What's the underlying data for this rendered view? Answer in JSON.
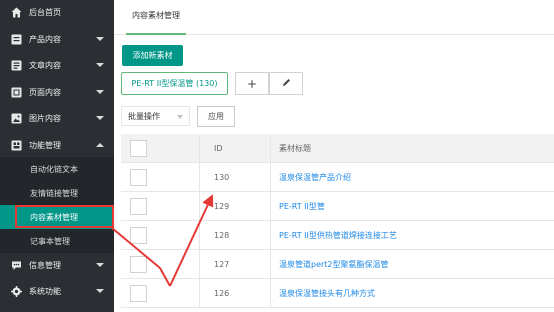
{
  "sidebar": {
    "items": [
      {
        "label": "后台首页",
        "icon": "home-icon",
        "caret": false
      },
      {
        "label": "产品内容",
        "icon": "doc-icon",
        "caret": "down"
      },
      {
        "label": "文章内容",
        "icon": "list-icon",
        "caret": "down"
      },
      {
        "label": "页面内容",
        "icon": "page-icon",
        "caret": "down"
      },
      {
        "label": "图片内容",
        "icon": "image-icon",
        "caret": "down"
      },
      {
        "label": "功能管理",
        "icon": "function-icon",
        "caret": "up"
      }
    ],
    "subitems": [
      {
        "label": "自动化链文本"
      },
      {
        "label": "友情链接管理"
      },
      {
        "label": "内容素材管理",
        "active": true
      },
      {
        "label": "记事本管理"
      }
    ],
    "bottom_items": [
      {
        "label": "信息管理",
        "icon": "chat-icon",
        "caret": "down"
      },
      {
        "label": "系统功能",
        "icon": "gear-icon",
        "caret": "down"
      }
    ]
  },
  "tab": {
    "label": "内容素材管理"
  },
  "toolbar": {
    "add_label": "添加新素材",
    "category_label": "PE-RT II型保温管 (130)",
    "plus_glyph": "+",
    "batch_label": "批量操作",
    "apply_label": "应用"
  },
  "table": {
    "headers": {
      "id": "ID",
      "title": "素材标题"
    },
    "rows": [
      {
        "id": "130",
        "title": "温泉保温管产品介绍"
      },
      {
        "id": "129",
        "title": "PE-RT II型管"
      },
      {
        "id": "128",
        "title": "PE-RT II型供热管道焊接连接工艺"
      },
      {
        "id": "127",
        "title": "温泉管道pert2型聚氨酯保温管"
      },
      {
        "id": "126",
        "title": "温泉保温管接头有几种方式"
      }
    ]
  },
  "annotation": {
    "highlight_color": "#e53935"
  }
}
